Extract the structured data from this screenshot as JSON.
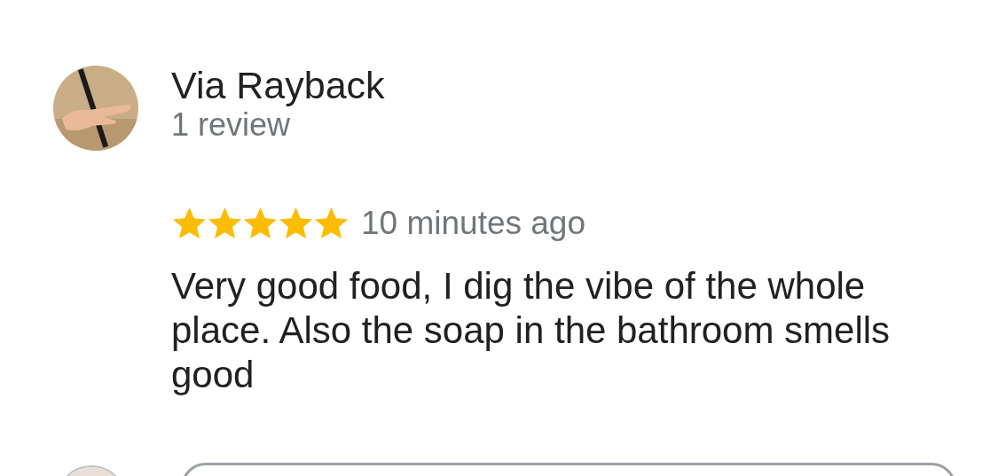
{
  "review": {
    "author": "Via Rayback",
    "author_meta": "1 review",
    "stars": 5,
    "time": "10 minutes ago",
    "text": "Very good food, I dig the vibe of the whole place. Also the soap in the bathroom smells good"
  }
}
